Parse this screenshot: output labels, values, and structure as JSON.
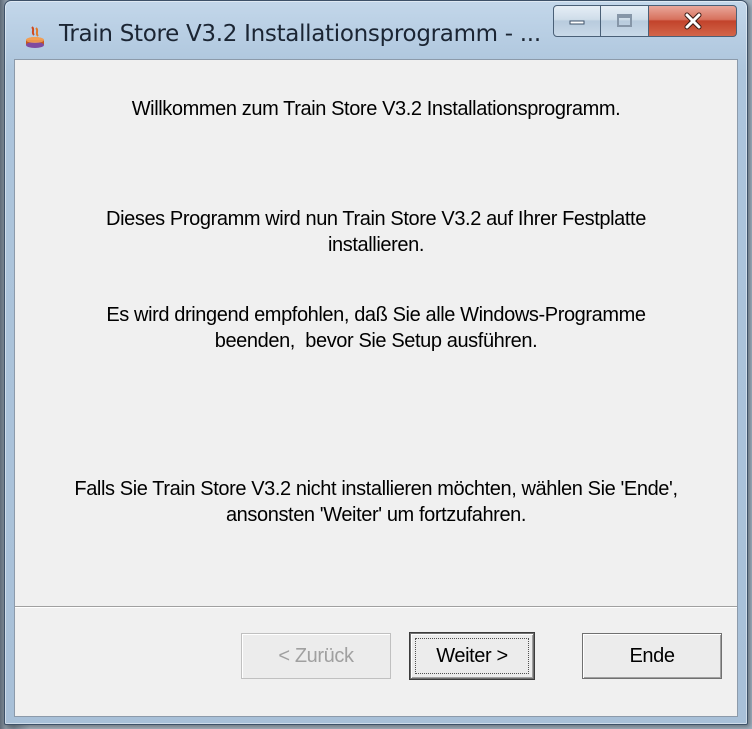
{
  "window": {
    "title": "Train Store V3.2 Installationsprogramm - ...",
    "icon": "installer-icon",
    "caption_buttons": [
      "minimize",
      "maximize",
      "close"
    ]
  },
  "content": {
    "welcome": "Willkommen zum Train Store V3.2 Installationsprogramm.",
    "paragraph1_line1": "Dieses Programm wird nun Train Store V3.2 auf Ihrer Festplatte",
    "paragraph1_line2": "installieren.",
    "paragraph2_line1": "Es wird dringend empfohlen, daß Sie alle Windows-Programme",
    "paragraph2_line2": "beenden,  bevor Sie Setup ausführen.",
    "paragraph3_line1": "Falls Sie Train Store V3.2 nicht installieren möchten, wählen Sie 'Ende',",
    "paragraph3_line2": "ansonsten 'Weiter' um fortzufahren."
  },
  "buttons": {
    "back": "< Zurück",
    "next": "Weiter >",
    "end": "Ende"
  },
  "colors": {
    "title_bar": "#b9cfe4",
    "close_button": "#c2432b",
    "dialog_bg": "#f0f0f0",
    "disabled_text": "#a0a0a0"
  }
}
